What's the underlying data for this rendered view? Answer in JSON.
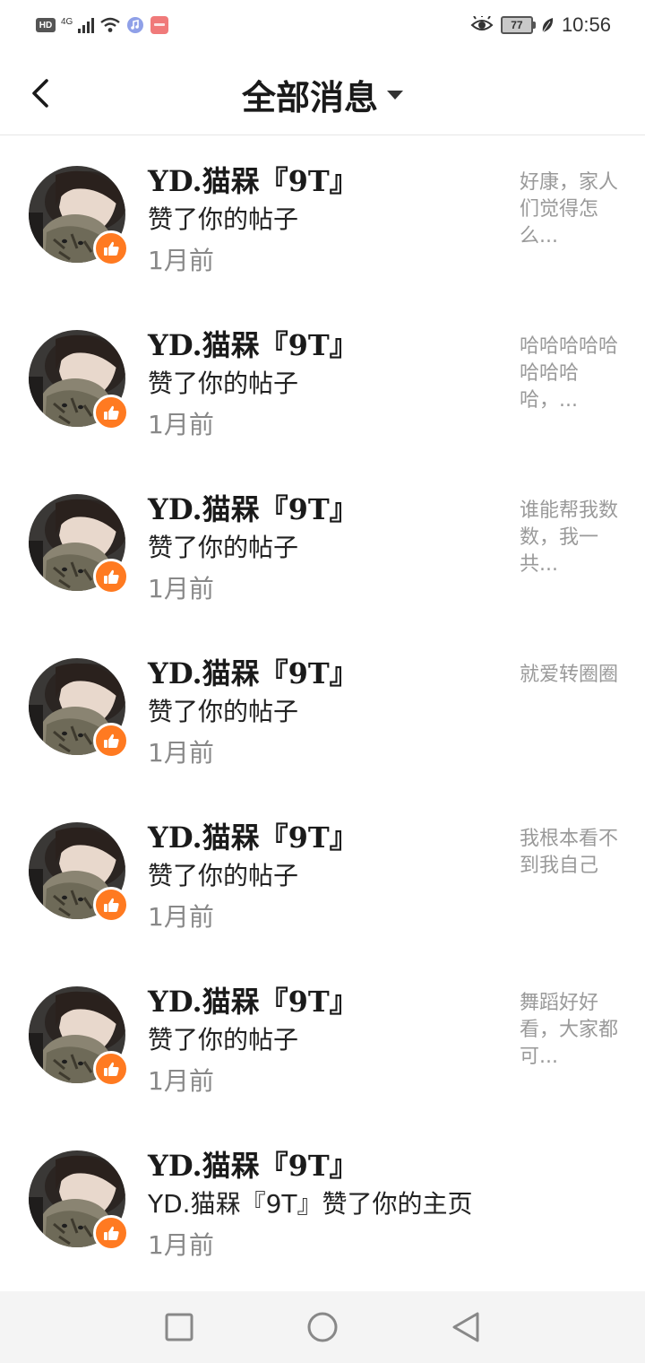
{
  "status_bar": {
    "hd": "HD",
    "network": "4G",
    "battery": "77",
    "time": "10:56"
  },
  "header": {
    "title": "全部消息"
  },
  "messages": [
    {
      "name": "YD.猫槑『9T』",
      "action": "赞了你的帖子",
      "time": "1月前",
      "preview": "好康，家人们觉得怎么..."
    },
    {
      "name": "YD.猫槑『9T』",
      "action": "赞了你的帖子",
      "time": "1月前",
      "preview": "哈哈哈哈哈哈哈哈哈，..."
    },
    {
      "name": "YD.猫槑『9T』",
      "action": "赞了你的帖子",
      "time": "1月前",
      "preview": "谁能帮我数数，我一共..."
    },
    {
      "name": "YD.猫槑『9T』",
      "action": "赞了你的帖子",
      "time": "1月前",
      "preview": "就爱转圈圈"
    },
    {
      "name": "YD.猫槑『9T』",
      "action": "赞了你的帖子",
      "time": "1月前",
      "preview": "我根本看不到我自己"
    },
    {
      "name": "YD.猫槑『9T』",
      "action": "赞了你的帖子",
      "time": "1月前",
      "preview": "舞蹈好好看，大家都可..."
    },
    {
      "name": "YD.猫槑『9T』",
      "action": "YD.猫槑『9T』赞了你的主页",
      "time": "1月前",
      "preview": ""
    }
  ],
  "colors": {
    "badge": "#ff7a21",
    "secondary_text": "#888888",
    "preview_text": "#9a9a9a"
  },
  "icons": {
    "back": "chevron-left-icon",
    "dropdown": "caret-down-icon",
    "badge": "thumbs-up-icon",
    "nav": [
      "square-recents-icon",
      "circle-home-icon",
      "triangle-back-icon"
    ]
  }
}
